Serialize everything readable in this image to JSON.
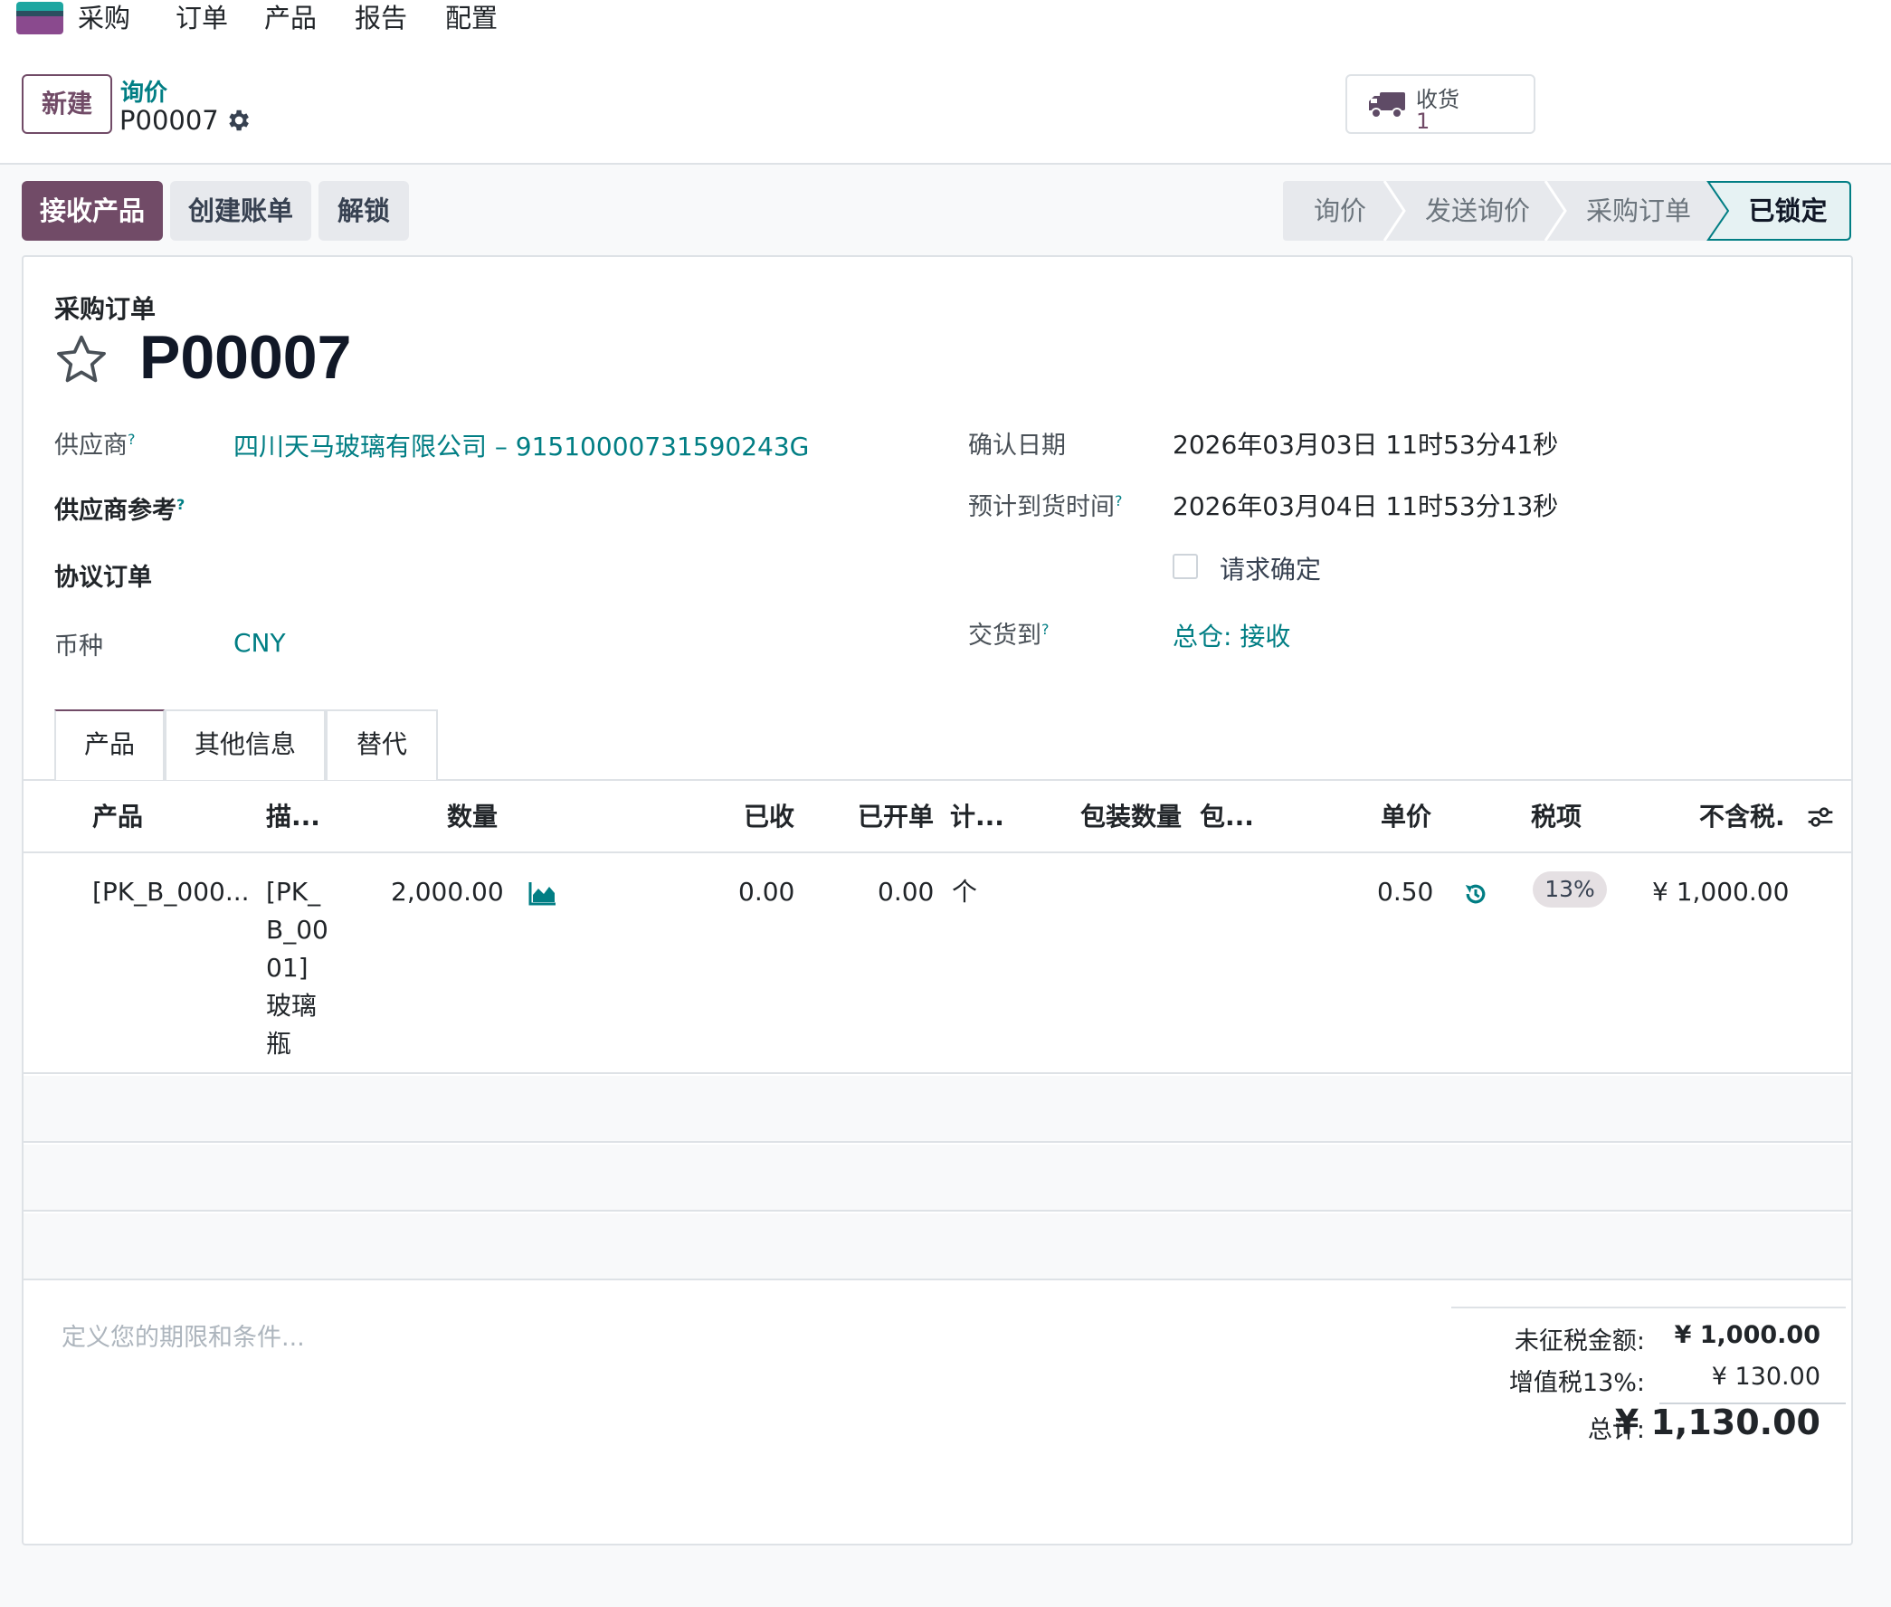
{
  "topnav": {
    "app_name": "采购",
    "menu": [
      "订单",
      "产品",
      "报告",
      "配置"
    ]
  },
  "header": {
    "new_button": "新建",
    "breadcrumb_parent": "询价",
    "breadcrumb_current": "P00007",
    "smart_button": {
      "label": "收货",
      "count": "1",
      "icon": "truck-icon"
    }
  },
  "actions": {
    "primary": "接收产品",
    "create_bill": "创建账单",
    "unlock": "解锁"
  },
  "status": {
    "stages": [
      "询价",
      "发送询价",
      "采购订单",
      "已锁定"
    ],
    "active": "已锁定"
  },
  "form": {
    "doc_type": "采购订单",
    "doc_name": "P00007",
    "vendor_label": "供应商",
    "vendor_value": "四川天马玻璃有限公司 – 91510000731590243G",
    "vendor_ref_label": "供应商参考",
    "agreement_label": "协议订单",
    "currency_label": "币种",
    "currency_value": "CNY",
    "confirm_date_label": "确认日期",
    "confirm_date_value": "2026年03月03日 11时53分41秒",
    "expected_arrival_label": "预计到货时间",
    "expected_arrival_value": "2026年03月04日 11时53分13秒",
    "request_confirm_label": "请求确定",
    "deliver_to_label": "交货到",
    "deliver_to_value": "总仓: 接收",
    "help_mark": "?"
  },
  "tabs": [
    "产品",
    "其他信息",
    "替代"
  ],
  "table": {
    "headers": [
      "产品",
      "描...",
      "数量",
      "已收",
      "已开单",
      "计...",
      "包装数量",
      "包...",
      "单价",
      "税项",
      "不含税."
    ],
    "rows": [
      {
        "product": "[PK_B_000...",
        "description": "[PK_B_0001] 玻璃瓶",
        "quantity": "2,000.00",
        "received": "0.00",
        "billed": "0.00",
        "uom": "个",
        "pack_qty": "",
        "packaging": "",
        "unit_price": "0.50",
        "tax": "13%",
        "subtotal": "¥ 1,000.00"
      }
    ]
  },
  "footer": {
    "terms_placeholder": "定义您的期限和条件...",
    "untaxed_label": "未征税金额:",
    "untaxed_value": "¥ 1,000.00",
    "vat_label": "增值税13%:",
    "vat_value": "¥ 130.00",
    "total_label": "总计:",
    "total_value": "¥ 1,130.00"
  },
  "colors": {
    "brand": "#714b67",
    "link": "#017e84",
    "active_stage_border": "#017e84"
  }
}
